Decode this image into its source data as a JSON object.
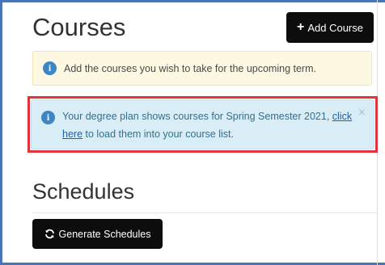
{
  "courses": {
    "title": "Courses",
    "add_button": {
      "icon": "plus-icon",
      "plus_glyph": "+",
      "label": "Add Course"
    }
  },
  "alerts": {
    "add_courses": {
      "icon": "info-icon",
      "text": "Add the courses you wish to take for the upcoming term."
    },
    "degree_plan": {
      "icon": "info-icon",
      "text_before": "Your degree plan shows   courses for Spring Semester 2021,",
      "link_text": "click here",
      "text_after": "to load them into your course list.",
      "close_glyph": "×",
      "highlight_color": "#e0343a"
    }
  },
  "schedules": {
    "title": "Schedules",
    "generate_button": {
      "icon": "refresh-icon",
      "label": "Generate Schedules"
    }
  },
  "colors": {
    "frame": "#4a74b8",
    "button_bg": "#0d0d0d",
    "warning_bg": "#fdf8e1",
    "info_bg": "#d9edf7",
    "info_text": "#31708f"
  }
}
